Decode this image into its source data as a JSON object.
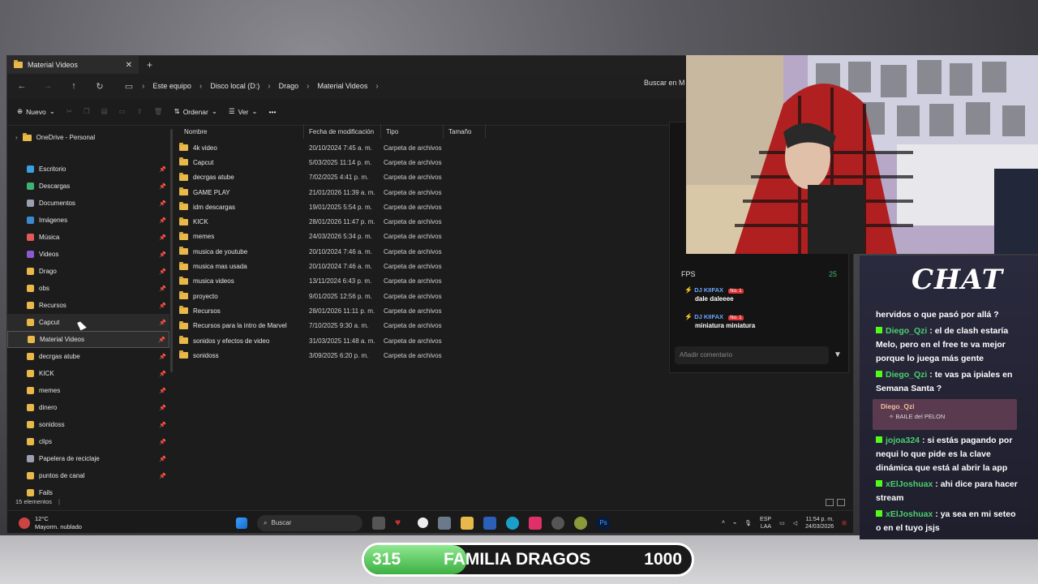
{
  "explorer": {
    "tab_title": "Material Videos",
    "close": "✕",
    "new_tab": "+",
    "breadcrumb": [
      "Este equipo",
      "Disco local (D:)",
      "Drago",
      "Material Videos"
    ],
    "search_placeholder": "Buscar en M",
    "toolbar": {
      "new": "Nuevo",
      "sort": "Ordenar",
      "view": "Ver",
      "more": "•••"
    },
    "sidebar": {
      "onedrive": "OneDrive - Personal",
      "items": [
        {
          "label": "Escritorio",
          "color": "#3aa0e0"
        },
        {
          "label": "Descargas",
          "color": "#3cb371"
        },
        {
          "label": "Documentos",
          "color": "#9aa0b0"
        },
        {
          "label": "Imágenes",
          "color": "#3a8ad0"
        },
        {
          "label": "Música",
          "color": "#e05a5a"
        },
        {
          "label": "Videos",
          "color": "#8a5ad0"
        },
        {
          "label": "Drago",
          "color": "#e8b94a"
        },
        {
          "label": "obs",
          "color": "#e8b94a"
        },
        {
          "label": "Recursos",
          "color": "#e8b94a"
        },
        {
          "label": "Capcut",
          "color": "#e8b94a"
        },
        {
          "label": "Material Videos",
          "color": "#e8b94a"
        },
        {
          "label": "decrgas atube",
          "color": "#e8b94a"
        },
        {
          "label": "KICK",
          "color": "#e8b94a"
        },
        {
          "label": "memes",
          "color": "#e8b94a"
        },
        {
          "label": "dinero",
          "color": "#e8b94a"
        },
        {
          "label": "sonidoss",
          "color": "#e8b94a"
        },
        {
          "label": "clips",
          "color": "#e8b94a"
        },
        {
          "label": "Papelera de reciclaje",
          "color": "#9aa0b0"
        },
        {
          "label": "puntos de canal",
          "color": "#e8b94a"
        },
        {
          "label": "Fails",
          "color": "#e8b94a"
        }
      ]
    },
    "columns": {
      "name": "Nombre",
      "modified": "Fecha de modificación",
      "type": "Tipo",
      "size": "Tamaño"
    },
    "files": [
      {
        "name": "4k video",
        "date": "20/10/2024 7:45 a. m.",
        "type": "Carpeta de archivos"
      },
      {
        "name": "Capcut",
        "date": "5/03/2025 11:14 p. m.",
        "type": "Carpeta de archivos"
      },
      {
        "name": "decrgas atube",
        "date": "7/02/2025 4:41 p. m.",
        "type": "Carpeta de archivos"
      },
      {
        "name": "GAME PLAY",
        "date": "21/01/2026 11:39 a. m.",
        "type": "Carpeta de archivos"
      },
      {
        "name": "idm descargas",
        "date": "19/01/2025 5:54 p. m.",
        "type": "Carpeta de archivos"
      },
      {
        "name": "KICK",
        "date": "28/01/2026 11:47 p. m.",
        "type": "Carpeta de archivos"
      },
      {
        "name": "memes",
        "date": "24/03/2026 5:34 p. m.",
        "type": "Carpeta de archivos"
      },
      {
        "name": "musica de youtube",
        "date": "20/10/2024 7:46 a. m.",
        "type": "Carpeta de archivos"
      },
      {
        "name": "musica mas usada",
        "date": "20/10/2024 7:46 a. m.",
        "type": "Carpeta de archivos"
      },
      {
        "name": "musica videos",
        "date": "13/11/2024 6:43 p. m.",
        "type": "Carpeta de archivos"
      },
      {
        "name": "proyecto",
        "date": "9/01/2025 12:56 p. m.",
        "type": "Carpeta de archivos"
      },
      {
        "name": "Recursos",
        "date": "28/01/2026 11:11 p. m.",
        "type": "Carpeta de archivos"
      },
      {
        "name": "Recursos para la intro de Marvel",
        "date": "7/10/2025 9:30 a. m.",
        "type": "Carpeta de archivos"
      },
      {
        "name": "sonidos y efectos de video",
        "date": "31/03/2025 11:48 a. m.",
        "type": "Carpeta de archivos"
      },
      {
        "name": "sonidoss",
        "date": "3/09/2025 6:20 p. m.",
        "type": "Carpeta de archivos"
      }
    ],
    "status": "15 elementos"
  },
  "taskbar": {
    "temp": "12°C",
    "weather": "Mayorm. nublado",
    "search": "Buscar",
    "lang1": "ESP",
    "lang2": "LAA",
    "time": "11:54 p. m.",
    "date": "24/03/2026"
  },
  "overlay": {
    "fps_label": "FPS",
    "fps_value": "25",
    "messages": [
      {
        "user": "DJ KIIFAX",
        "badge": "No. 1",
        "text": "dale daleeee"
      },
      {
        "user": "DJ KIIFAX",
        "badge": "No. 1",
        "text": "miniatura miniatura"
      }
    ],
    "comment_placeholder": "Añadir comentario"
  },
  "chat": {
    "title": "CHAT",
    "messages": [
      {
        "user": "",
        "text": "hervidos o que pasó por allá ?"
      },
      {
        "user": "Diego_Qzi",
        "text": "el de clash estaría Melo, pero en el free te va mejor porque lo juega más gente"
      },
      {
        "user": "Diego_Qzi",
        "text": "te vas pa ipiales en Semana Santa ?"
      },
      {
        "user": "jojoa324",
        "text": "si estás pagando por nequi lo que pide es la clave dinámica que está al abrir la app"
      },
      {
        "user": "xElJoshuax",
        "text": "ahi dice para hacer stream"
      },
      {
        "user": "xElJoshuax",
        "text": "ya sea en mi seteo o en el tuyo jsjs"
      }
    ],
    "redeem": {
      "user": "Diego_Qzi",
      "reward": "BAILE del PELON"
    }
  },
  "goal": {
    "current": "315",
    "label": "FAMILIA DRAGOS",
    "target": "1000",
    "progress": 0.315
  }
}
